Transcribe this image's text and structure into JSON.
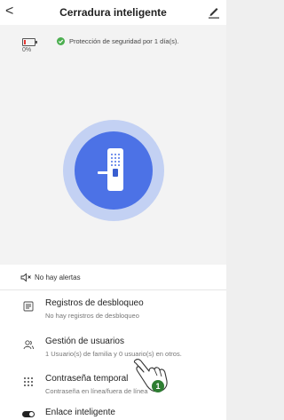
{
  "header": {
    "back": "<",
    "title": "Cerradura inteligente"
  },
  "status": {
    "battery_percent": "0%",
    "security_text": "Protección de seguridad por 1 día(s)."
  },
  "alert": {
    "text": "No hay alertas"
  },
  "menu": [
    {
      "label": "Registros de desbloqueo",
      "sub": "No hay registros de desbloqueo"
    },
    {
      "label": "Gestión de usuarios",
      "sub": "1 Usuario(s) de familia y 0 usuario(s) en otros."
    },
    {
      "label": "Contraseña temporal",
      "sub": "Contraseña en línea/fuera de línea"
    }
  ],
  "enlace": {
    "label": "Enlace inteligente"
  },
  "annotation": {
    "number": "1"
  },
  "colors": {
    "accent": "#4c72e6",
    "accent_light": "#c3d1f3",
    "shield": "#4caf50",
    "battery_low": "#e53935"
  }
}
